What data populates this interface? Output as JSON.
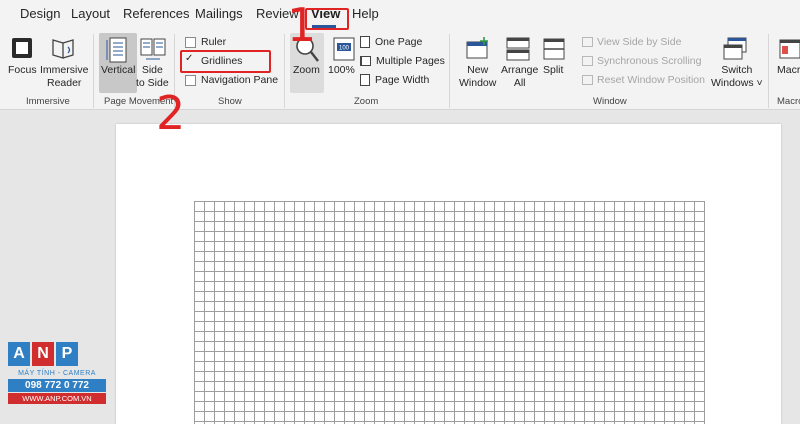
{
  "tabs": [
    {
      "label": "Design"
    },
    {
      "label": "Layout"
    },
    {
      "label": "References"
    },
    {
      "label": "Mailings"
    },
    {
      "label": "Review"
    },
    {
      "label": "View"
    },
    {
      "label": "Help"
    }
  ],
  "ribbon": {
    "immersive": {
      "focus": "Focus",
      "immersive_reader": [
        "Immersive",
        "Reader"
      ],
      "group": "Immersive"
    },
    "page_movement": {
      "vertical": "Vertical",
      "side_to_side": [
        "Side",
        "to Side"
      ],
      "group": "Page Movement"
    },
    "show": {
      "ruler": "Ruler",
      "gridlines": "Gridlines",
      "navigation_pane": "Navigation Pane",
      "group": "Show",
      "ruler_checked": false,
      "gridlines_checked": true,
      "navigation_checked": false
    },
    "zoom": {
      "zoom": "Zoom",
      "hundred": "100%",
      "hundred_icon": "100",
      "one_page": "One Page",
      "multiple_pages": "Multiple Pages",
      "page_width": "Page Width",
      "group": "Zoom"
    },
    "window": {
      "new_window": [
        "New",
        "Window"
      ],
      "arrange_all": [
        "Arrange",
        "All"
      ],
      "split": "Split",
      "view_side_by_side": "View Side by Side",
      "synchronous_scrolling": "Synchronous Scrolling",
      "reset_window_position": "Reset Window Position",
      "switch_windows": [
        "Switch",
        "Windows ˅"
      ],
      "group": "Window"
    },
    "macros": {
      "label": "Macros",
      "group": "Macros"
    }
  },
  "annotations": {
    "step1": "1",
    "step2": "2"
  },
  "logo": {
    "letters": [
      "A",
      "N",
      "P"
    ],
    "tagline": "MÁY TÍNH - CAMERA",
    "phone": "098 772 0 772",
    "website": "WWW.ANP.COM.VN"
  },
  "colors": {
    "accent": "#2b579a",
    "annotation": "#e02424",
    "logo_blue": "#2e7fc4",
    "logo_red": "#d02e2e"
  }
}
